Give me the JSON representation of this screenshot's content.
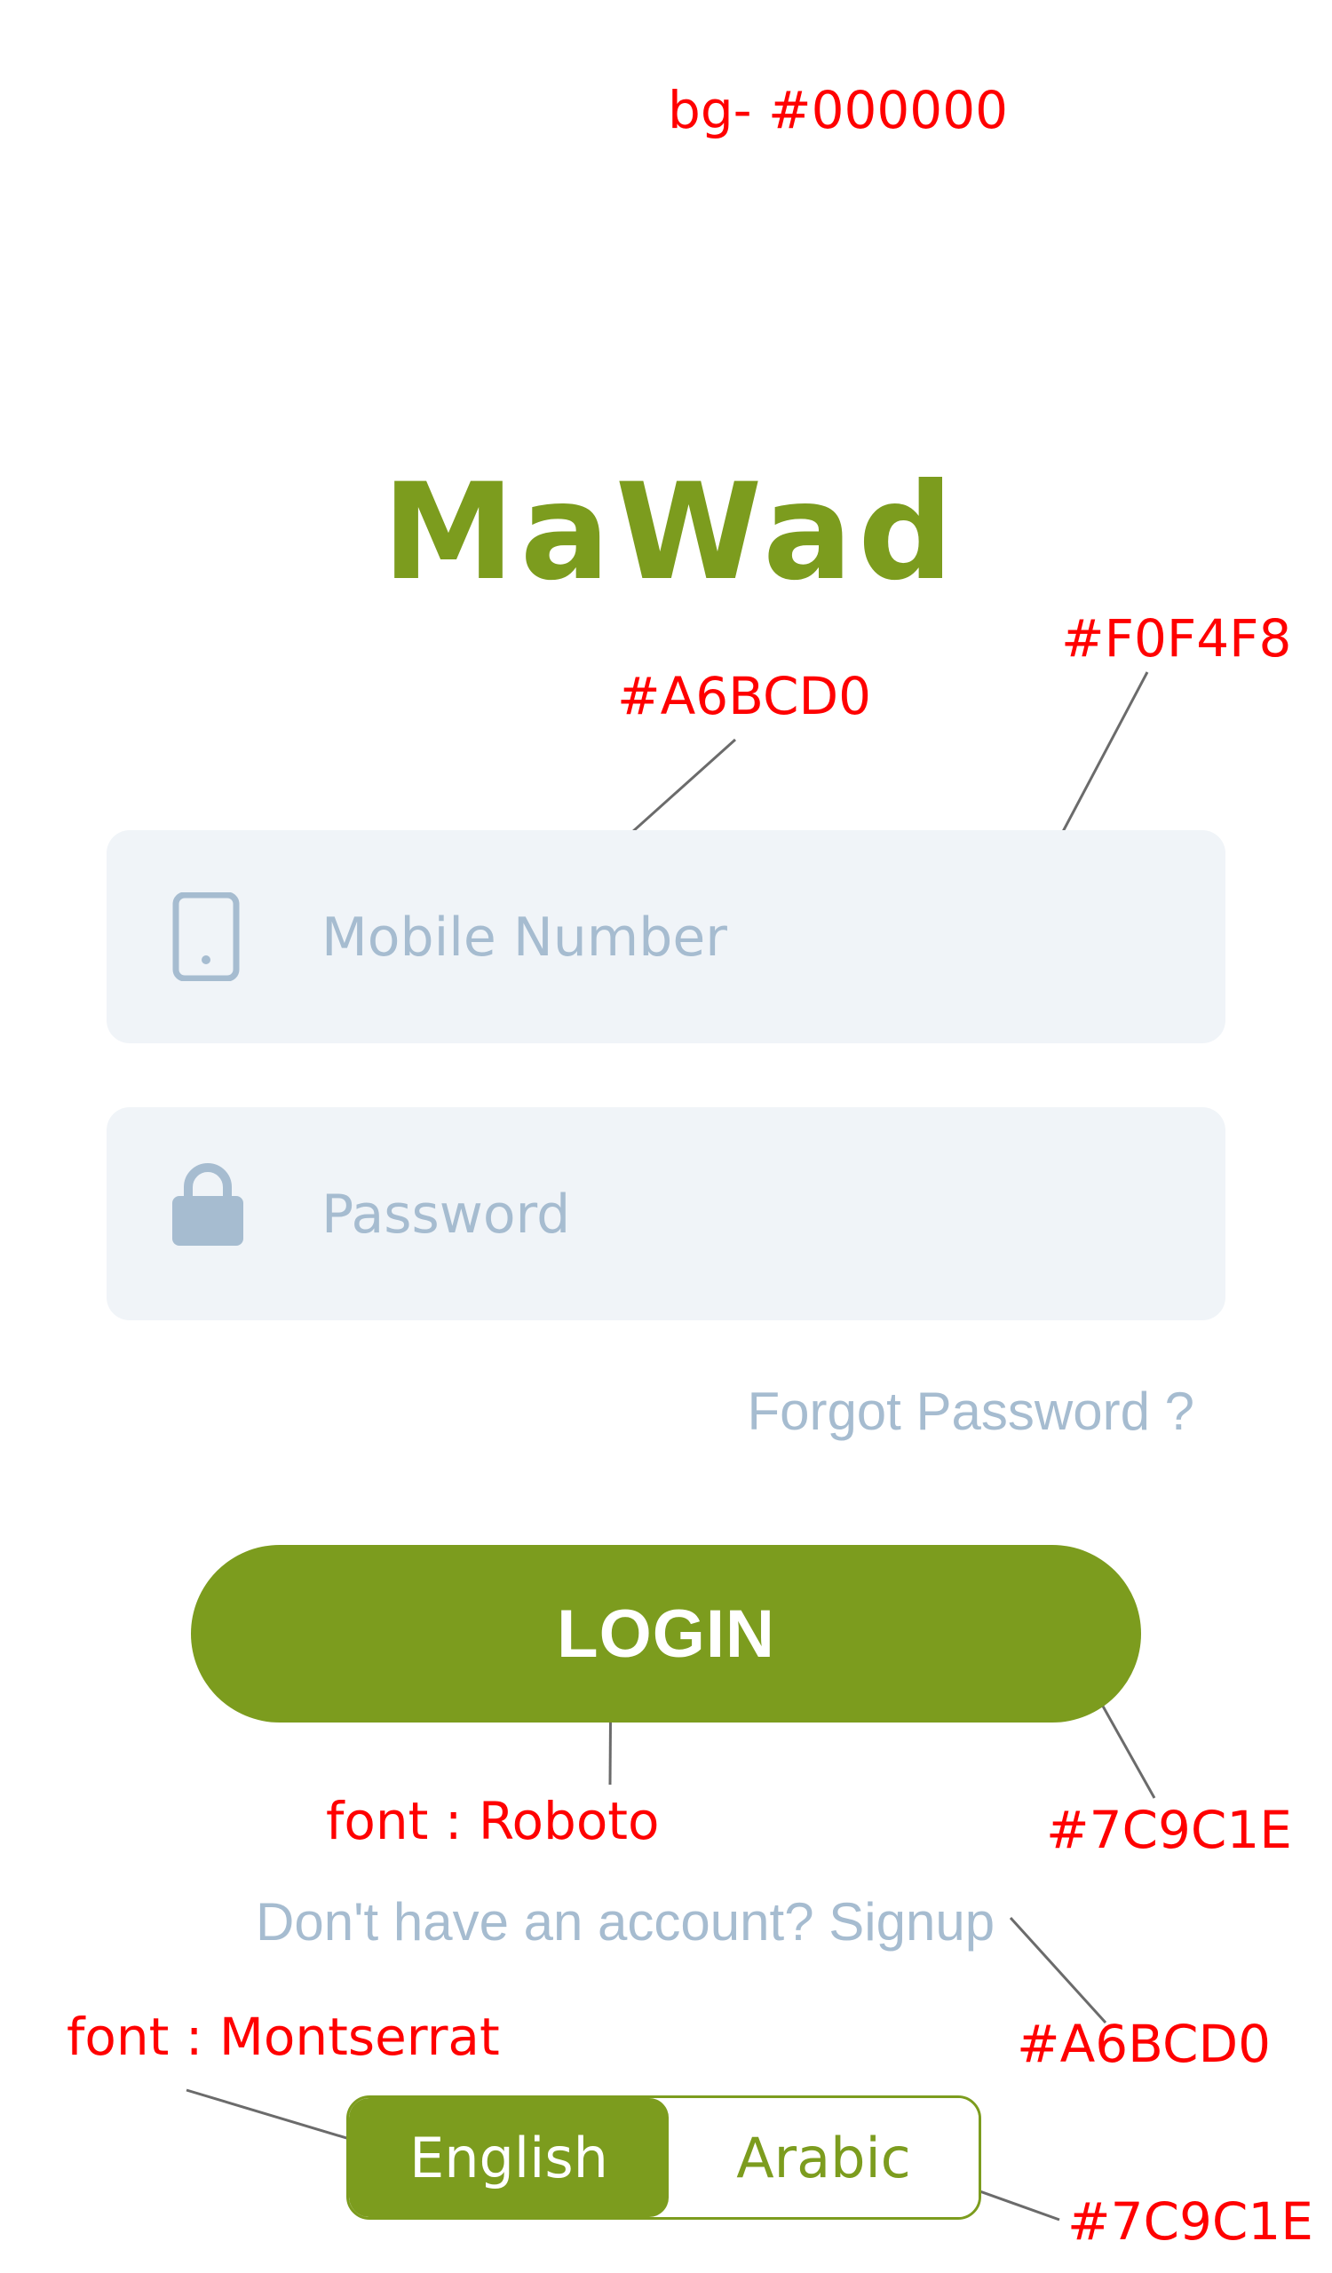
{
  "annotations": {
    "background": "bg- #000000",
    "input_text_color": "#A6BCD0",
    "input_bg_color": "#F0F4F8",
    "login_font": "font : Roboto",
    "login_color": "#7C9C1E",
    "signup_color": "#A6BCD0",
    "lang_font": "font : Montserrat",
    "lang_color": "#7C9C1E"
  },
  "logo": {
    "text": "MaWad"
  },
  "form": {
    "mobile": {
      "placeholder": "Mobile Number",
      "icon": "phone-icon"
    },
    "password": {
      "placeholder": "Password",
      "icon": "lock-icon"
    },
    "forgot_label": "Forgot Password ?",
    "login_label": "LOGIN"
  },
  "signup": {
    "prompt": "Don't have an account? ",
    "link": "Signup"
  },
  "language": {
    "options": [
      "English",
      "Arabic"
    ],
    "selected": "English"
  },
  "colors": {
    "brand": "#7C9C1E",
    "muted": "#A6BCD0",
    "field_bg": "#F0F4F8",
    "annotation": "#FF0000"
  }
}
